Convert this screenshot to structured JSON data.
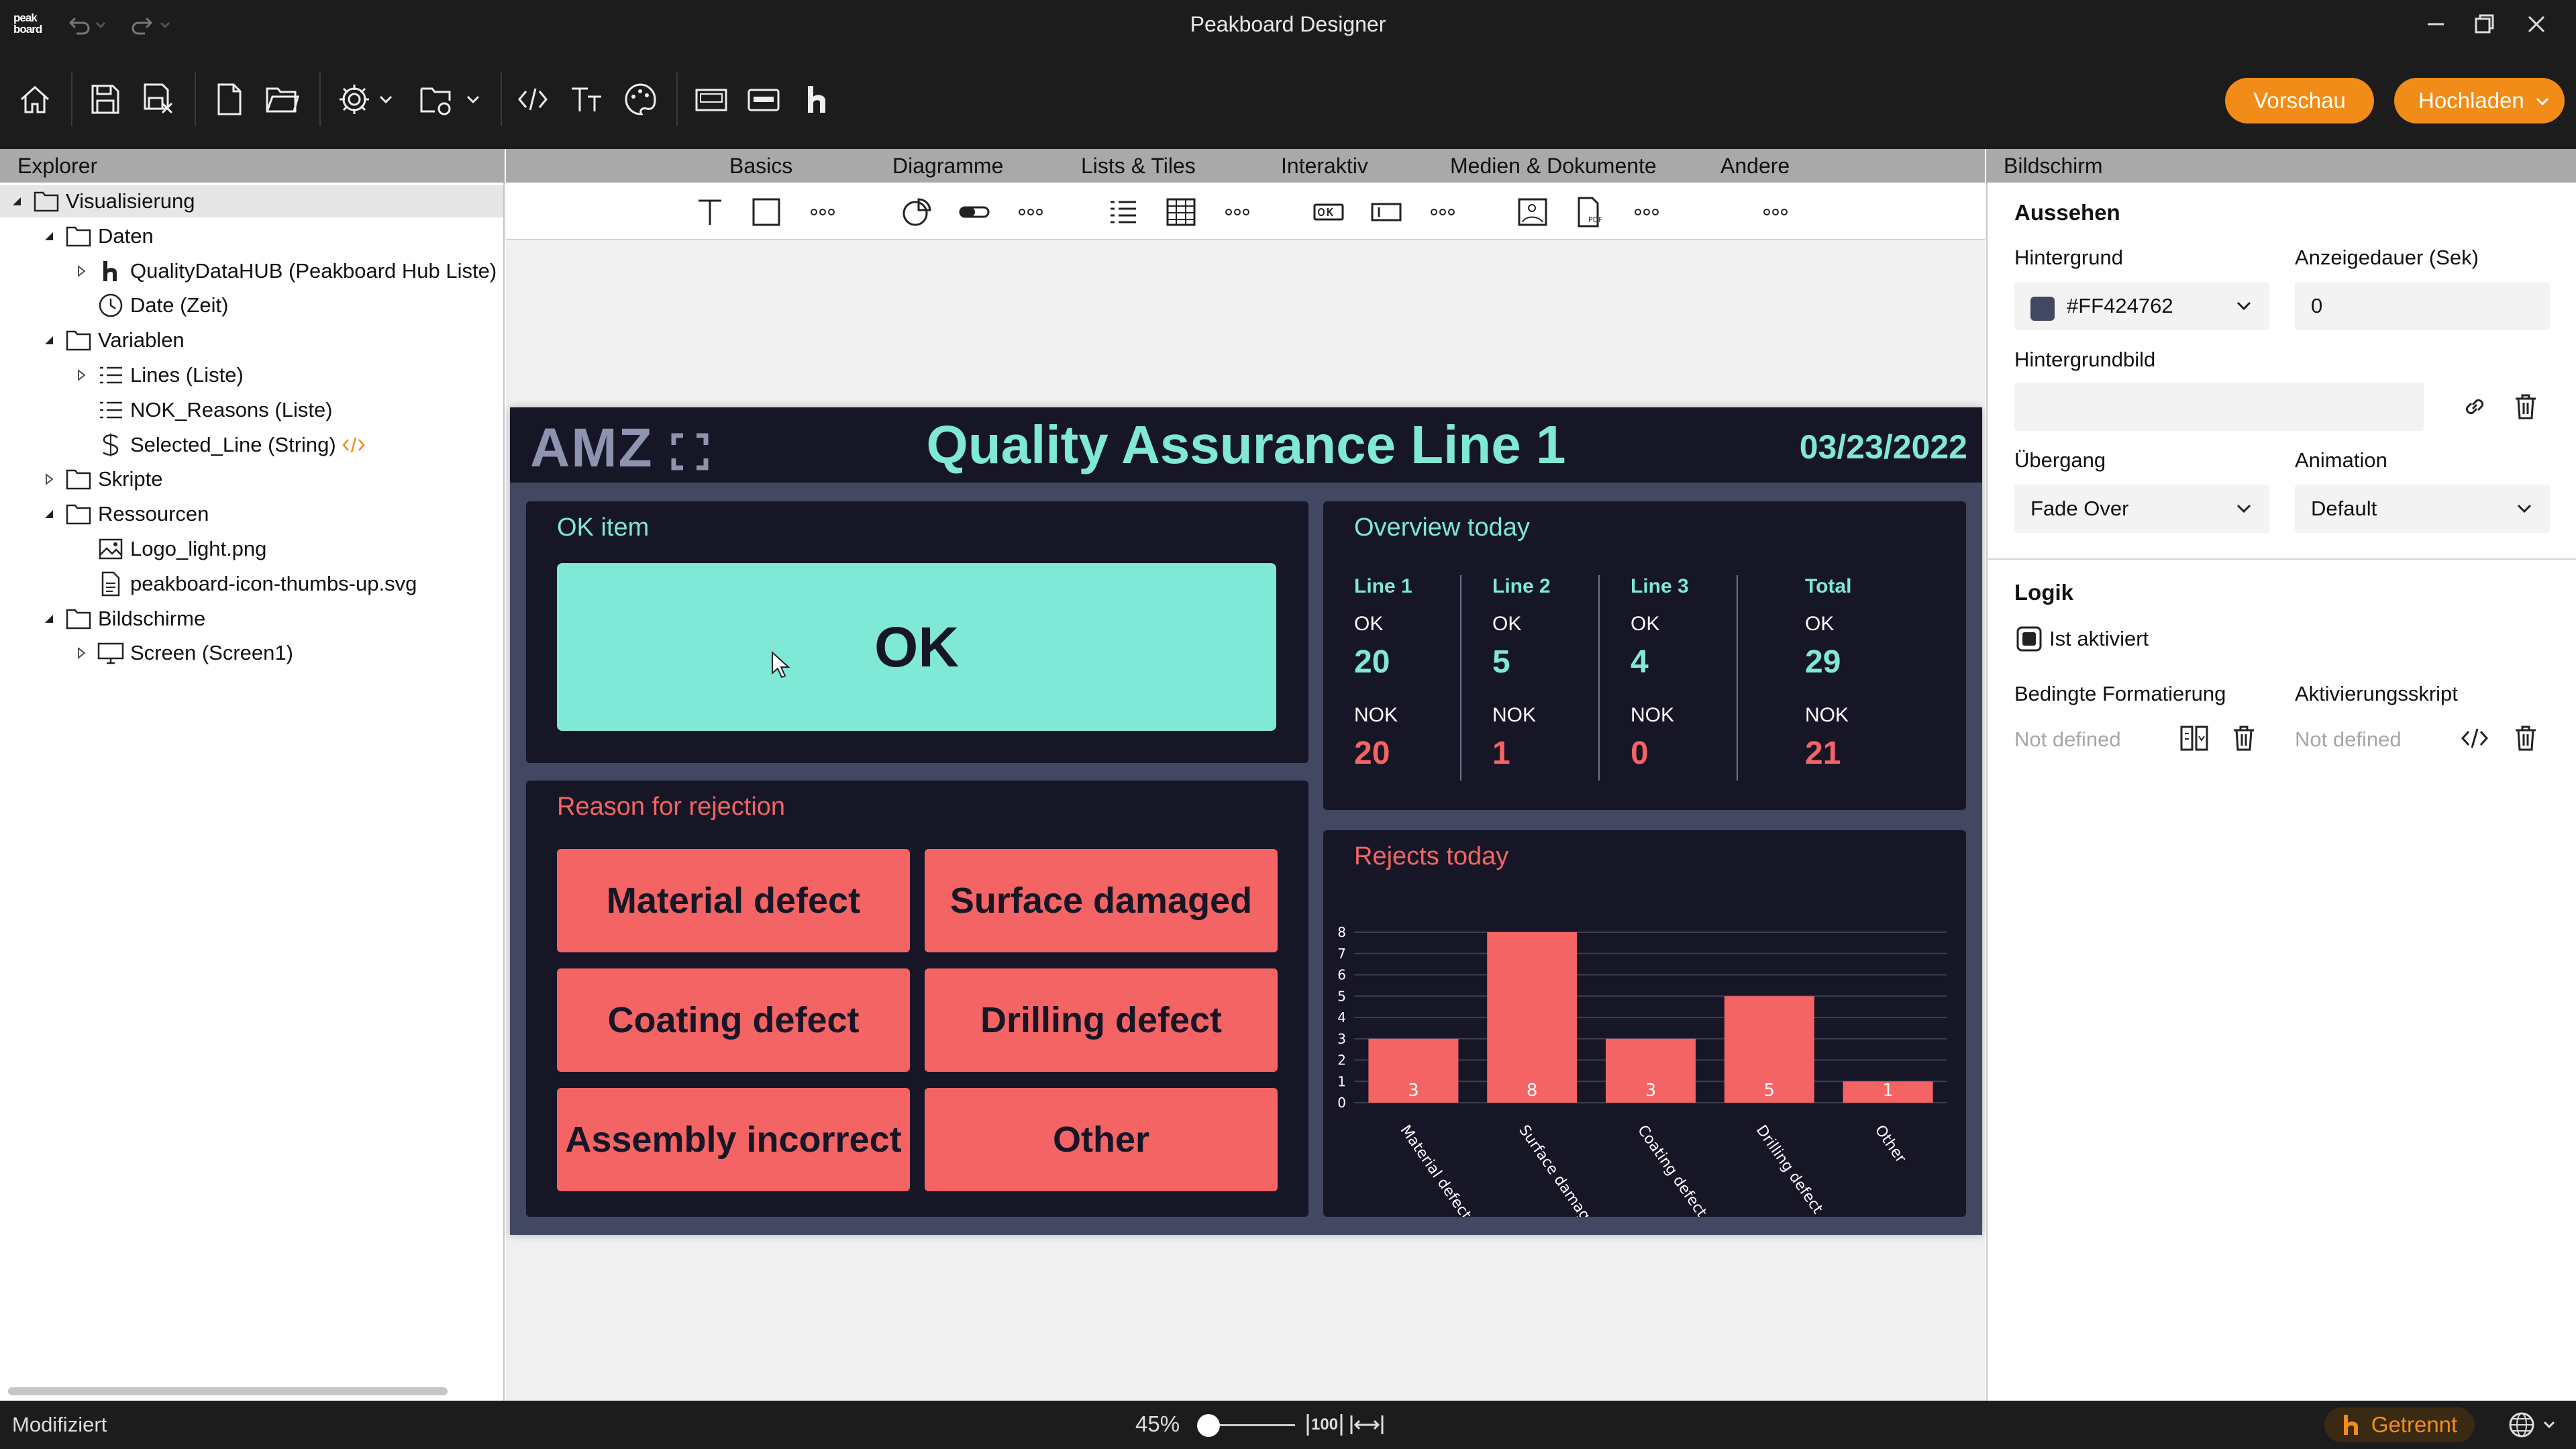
{
  "window": {
    "title": "Peakboard Designer",
    "logo_text": "peak board"
  },
  "toolbar": {
    "preview_label": "Vorschau",
    "upload_label": "Hochladen"
  },
  "explorer": {
    "header": "Explorer",
    "tree": [
      {
        "label": "Visualisierung",
        "icon": "folder-icon"
      },
      {
        "label": "Daten",
        "icon": "folder-icon"
      },
      {
        "label": "QualityDataHUB (Peakboard Hub Liste)",
        "icon": "hub-icon"
      },
      {
        "label": "Date (Zeit)",
        "icon": "clock-icon"
      },
      {
        "label": "Variablen",
        "icon": "folder-icon"
      },
      {
        "label": "Lines (Liste)",
        "icon": "list-icon"
      },
      {
        "label": "NOK_Reasons (Liste)",
        "icon": "list-icon"
      },
      {
        "label": "Selected_Line (String)",
        "icon": "string-icon"
      },
      {
        "label": "Skripte",
        "icon": "folder-icon"
      },
      {
        "label": "Ressourcen",
        "icon": "folder-icon"
      },
      {
        "label": "Logo_light.png",
        "icon": "image-icon"
      },
      {
        "label": "peakboard-icon-thumbs-up.svg",
        "icon": "file-icon"
      },
      {
        "label": "Bildschirme",
        "icon": "folder-icon"
      },
      {
        "label": "Screen (Screen1)",
        "icon": "monitor-icon"
      }
    ]
  },
  "palette": {
    "tabs": [
      "Basics",
      "Diagramme",
      "Lists & Tiles",
      "Interaktiv",
      "Medien & Dokumente",
      "Andere"
    ]
  },
  "dashboard": {
    "brand": "AMZ",
    "title": "Quality Assurance Line  1",
    "date": "03/23/2022",
    "ok_panel": {
      "title": "OK item",
      "button": "OK"
    },
    "reason_panel": {
      "title": "Reason for rejection",
      "reasons": [
        "Material defect",
        "Surface damaged",
        "Coating defect",
        "Drilling defect",
        "Assembly incorrect",
        "Other"
      ]
    },
    "overview": {
      "title": "Overview today",
      "columns": [
        {
          "label": "Line 1",
          "ok_label": "OK",
          "ok": "20",
          "nok_label": "NOK",
          "nok": "20"
        },
        {
          "label": "Line 2",
          "ok_label": "OK",
          "ok": "5",
          "nok_label": "NOK",
          "nok": "1"
        },
        {
          "label": "Line 3",
          "ok_label": "OK",
          "ok": "4",
          "nok_label": "NOK",
          "nok": "0"
        },
        {
          "label": "Total",
          "ok_label": "OK",
          "ok": "29",
          "nok_label": "NOK",
          "nok": "21"
        }
      ]
    },
    "rejects": {
      "title": "Rejects today"
    },
    "colors": {
      "teal": "#7fe8d6",
      "coral": "#f46464",
      "panel": "#161626",
      "background": "#424762"
    }
  },
  "chart_data": {
    "type": "bar",
    "title": "Rejects today",
    "categories": [
      "Material defect",
      "Surface damaged",
      "Coating defect",
      "Drilling defect",
      "Other"
    ],
    "values": [
      3,
      8,
      3,
      5,
      1
    ],
    "ylim": [
      0,
      8
    ],
    "yticks": [
      0,
      1,
      2,
      3,
      4,
      5,
      6,
      7,
      8
    ],
    "grid": true,
    "bar_color": "#f46464"
  },
  "properties": {
    "header": "Bildschirm",
    "appearance_title": "Aussehen",
    "background_label": "Hintergrund",
    "background_value": "#FF424762",
    "background_swatch": "#424762",
    "duration_label": "Anzeigedauer (Sek)",
    "duration_value": "0",
    "bgimage_label": "Hintergrundbild",
    "transition_label": "Übergang",
    "transition_value": "Fade Over",
    "animation_label": "Animation",
    "animation_value": "Default",
    "logic_title": "Logik",
    "enabled_label": "Ist aktiviert",
    "cond_format_label": "Bedingte Formatierung",
    "cond_format_value": "Not defined",
    "activation_label": "Aktivierungsskript",
    "activation_value": "Not defined"
  },
  "statusbar": {
    "status": "Modifiziert",
    "zoom": "45%",
    "zoom_fraction": 0.45,
    "zoom_100": "100",
    "connection": "Getrennt"
  }
}
